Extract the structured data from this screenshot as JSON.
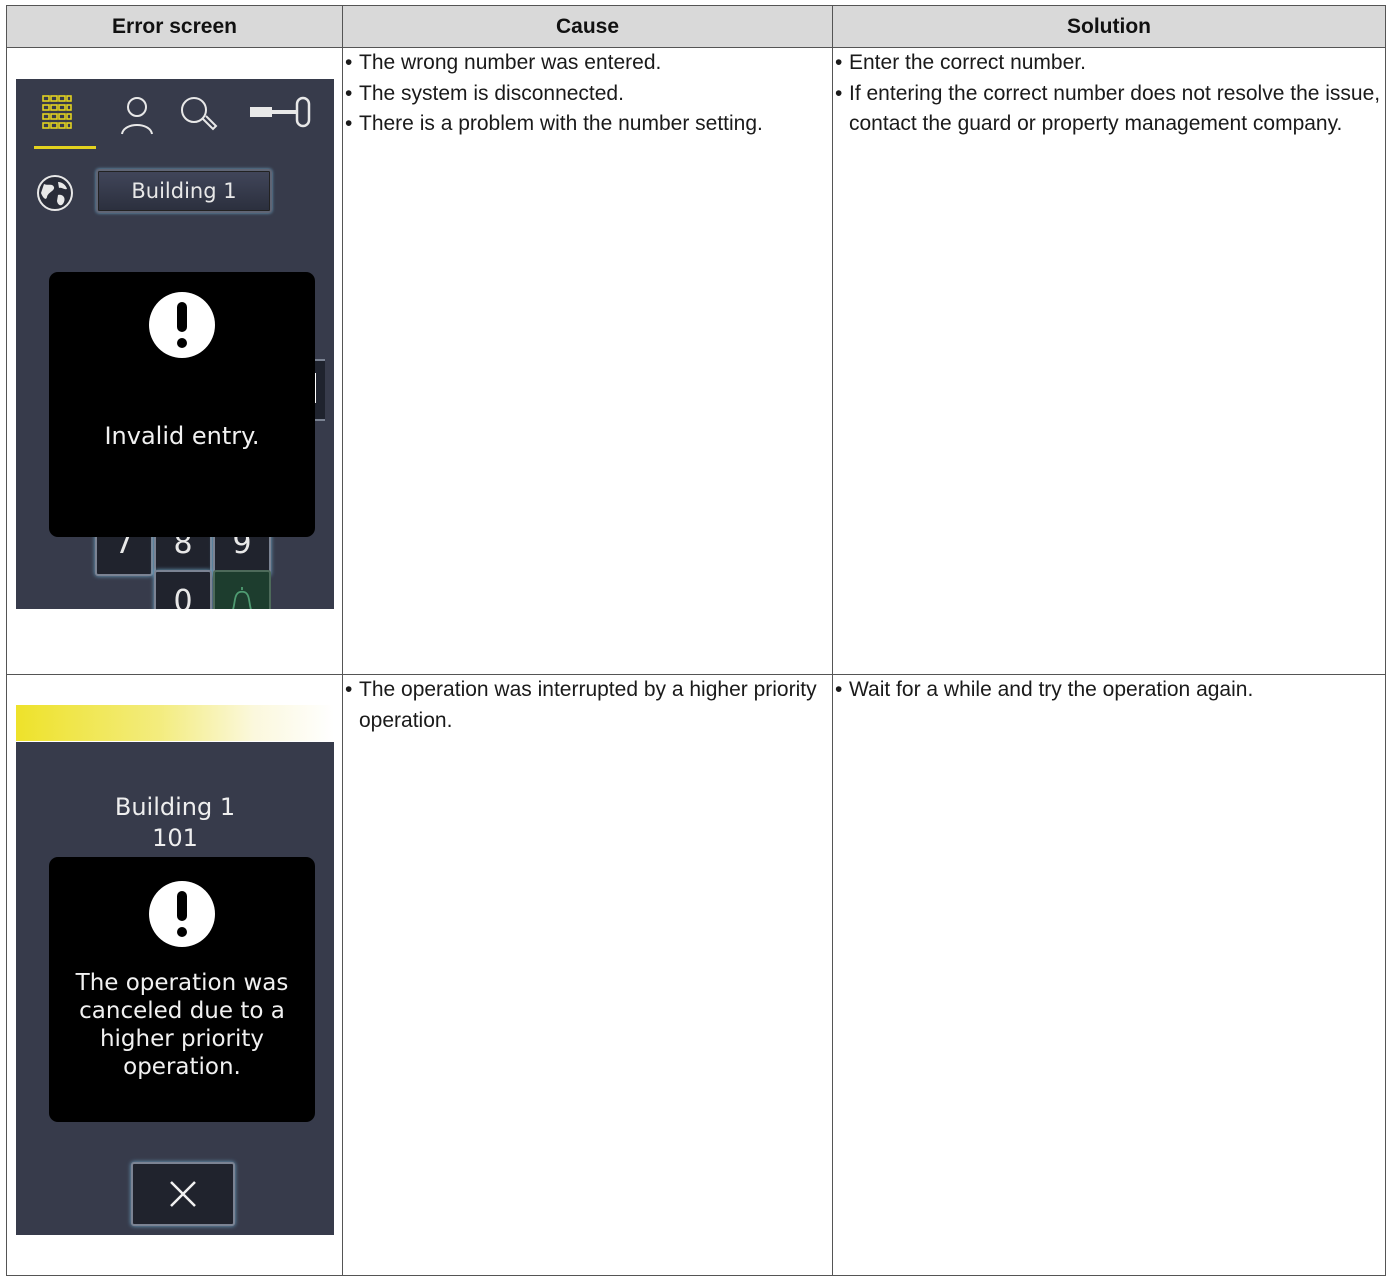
{
  "headers": [
    "Error screen",
    "Cause",
    "Solution"
  ],
  "rows": [
    {
      "screen": {
        "building_button": "Building 1",
        "keys": [
          "7",
          "8",
          "9",
          "0"
        ],
        "popup_message": "Invalid entry."
      },
      "causes": [
        "The wrong number was entered.",
        "The system is disconnected.",
        "There is a problem with the number setting."
      ],
      "solutions": [
        "Enter the correct number.",
        "If entering the correct number does not resolve the issue, contact the guard or property management company."
      ]
    },
    {
      "screen": {
        "building": "Building 1",
        "unit": "101",
        "popup_message": "The operation was canceled due to a higher priority operation."
      },
      "causes": [
        "The operation was interrupted by a higher priority operation."
      ],
      "solutions": [
        "Wait for a while and try the operation again."
      ]
    }
  ],
  "colors": {
    "screen_bg": "#373b4b",
    "accent_tab": "#e3d21f",
    "header_bg": "#d9d9d9",
    "banner": "#eee22a"
  },
  "icons": [
    "keypad-icon",
    "person-icon",
    "search-icon",
    "key-icon",
    "globe-icon",
    "exclamation-icon",
    "bell-icon",
    "close-icon"
  ]
}
